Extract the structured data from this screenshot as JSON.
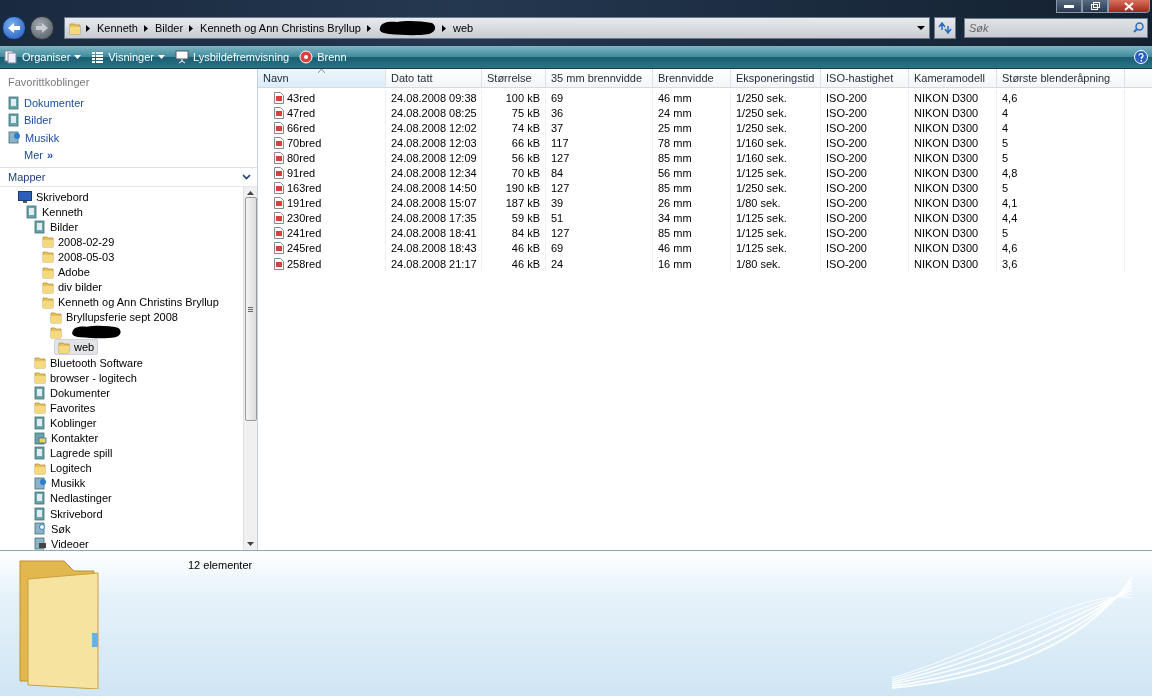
{
  "address_bar": {
    "segments": [
      {
        "kind": "text",
        "label": "Kenneth"
      },
      {
        "kind": "text",
        "label": "Bilder"
      },
      {
        "kind": "text",
        "label": "Kenneth og Ann Christins Bryllup"
      },
      {
        "kind": "redacted"
      },
      {
        "kind": "text",
        "label": "web"
      }
    ]
  },
  "search": {
    "placeholder": "Søk"
  },
  "toolbar": [
    {
      "label": "Organiser",
      "dropdown": true
    },
    {
      "label": "Visninger",
      "dropdown": true
    },
    {
      "label": "Lysbildefremvisning",
      "dropdown": false
    },
    {
      "label": "Brenn",
      "dropdown": false
    }
  ],
  "favorites": {
    "title": "Favorittkoblinger",
    "links": [
      {
        "kind": "documents",
        "label": "Dokumenter"
      },
      {
        "kind": "pictures",
        "label": "Bilder"
      },
      {
        "kind": "music",
        "label": "Musikk"
      },
      {
        "kind": "more",
        "label": "Mer",
        "glyph": "»"
      }
    ]
  },
  "folders": {
    "title": "Mapper",
    "tree": [
      {
        "kind": "desktop",
        "label": "Skrivebord",
        "selected": false,
        "children": [
          {
            "kind": "user",
            "label": "Kenneth",
            "selected": false,
            "children": [
              {
                "kind": "library",
                "label": "Bilder",
                "selected": false,
                "children": [
                  {
                    "kind": "folder",
                    "label": "2008-02-29",
                    "selected": false
                  },
                  {
                    "kind": "folder",
                    "label": "2008-05-03",
                    "selected": false
                  },
                  {
                    "kind": "folder",
                    "label": "Adobe",
                    "selected": false
                  },
                  {
                    "kind": "folder",
                    "label": "div bilder",
                    "selected": false
                  },
                  {
                    "kind": "folder",
                    "label": "Kenneth og Ann Christins Bryllup",
                    "selected": false,
                    "children": [
                      {
                        "kind": "folder",
                        "label": "Bryllupsferie sept 2008",
                        "selected": false
                      },
                      {
                        "kind": "redacted",
                        "selected": false,
                        "children": [
                          {
                            "kind": "folder",
                            "label": "web",
                            "selected": true
                          }
                        ]
                      }
                    ]
                  }
                ]
              },
              {
                "kind": "folder",
                "label": "Bluetooth Software",
                "selected": false
              },
              {
                "kind": "folder",
                "label": "browser - logitech",
                "selected": false
              },
              {
                "kind": "library",
                "label": "Dokumenter",
                "selected": false
              },
              {
                "kind": "folder",
                "label": "Favorites",
                "selected": false
              },
              {
                "kind": "library",
                "label": "Koblinger",
                "selected": false
              },
              {
                "kind": "contacts",
                "label": "Kontakter",
                "selected": false
              },
              {
                "kind": "library",
                "label": "Lagrede spill",
                "selected": false
              },
              {
                "kind": "folder",
                "label": "Logitech",
                "selected": false
              },
              {
                "kind": "music",
                "label": "Musikk",
                "selected": false
              },
              {
                "kind": "library",
                "label": "Nedlastinger",
                "selected": false
              },
              {
                "kind": "library",
                "label": "Skrivebord",
                "selected": false
              },
              {
                "kind": "search",
                "label": "Søk",
                "selected": false
              },
              {
                "kind": "video",
                "label": "Videoer",
                "selected": false
              }
            ]
          }
        ]
      }
    ]
  },
  "table": {
    "columns": [
      {
        "label": "Navn",
        "sorted": true
      },
      {
        "label": "Dato tatt",
        "sorted": false
      },
      {
        "label": "Størrelse",
        "sorted": false
      },
      {
        "label": "35 mm brennvidde",
        "sorted": false
      },
      {
        "label": "Brennvidde",
        "sorted": false
      },
      {
        "label": "Eksponeringstid",
        "sorted": false
      },
      {
        "label": "ISO-hastighet",
        "sorted": false
      },
      {
        "label": "Kameramodell",
        "sorted": false
      },
      {
        "label": "Største blenderåpning",
        "sorted": false
      }
    ],
    "rows": [
      [
        "43red",
        "24.08.2008 09:38",
        "100 kB",
        "69",
        "46 mm",
        "1/250 sek.",
        "ISO-200",
        "NIKON D300",
        "4,6"
      ],
      [
        "47red",
        "24.08.2008 08:25",
        "75 kB",
        "36",
        "24 mm",
        "1/250 sek.",
        "ISO-200",
        "NIKON D300",
        "4"
      ],
      [
        "66red",
        "24.08.2008 12:02",
        "74 kB",
        "37",
        "25 mm",
        "1/250 sek.",
        "ISO-200",
        "NIKON D300",
        "4"
      ],
      [
        "70bred",
        "24.08.2008 12:03",
        "66 kB",
        "117",
        "78 mm",
        "1/160 sek.",
        "ISO-200",
        "NIKON D300",
        "5"
      ],
      [
        "80red",
        "24.08.2008 12:09",
        "56 kB",
        "127",
        "85 mm",
        "1/160 sek.",
        "ISO-200",
        "NIKON D300",
        "5"
      ],
      [
        "91red",
        "24.08.2008 12:34",
        "70 kB",
        "84",
        "56 mm",
        "1/125 sek.",
        "ISO-200",
        "NIKON D300",
        "4,8"
      ],
      [
        "163red",
        "24.08.2008 14:50",
        "190 kB",
        "127",
        "85 mm",
        "1/250 sek.",
        "ISO-200",
        "NIKON D300",
        "5"
      ],
      [
        "191red",
        "24.08.2008 15:07",
        "187 kB",
        "39",
        "26 mm",
        "1/80 sek.",
        "ISO-200",
        "NIKON D300",
        "4,1"
      ],
      [
        "230red",
        "24.08.2008 17:35",
        "59 kB",
        "51",
        "34 mm",
        "1/125 sek.",
        "ISO-200",
        "NIKON D300",
        "4,4"
      ],
      [
        "241red",
        "24.08.2008 18:41",
        "84 kB",
        "127",
        "85 mm",
        "1/125 sek.",
        "ISO-200",
        "NIKON D300",
        "5"
      ],
      [
        "245red",
        "24.08.2008 18:43",
        "46 kB",
        "69",
        "46 mm",
        "1/125 sek.",
        "ISO-200",
        "NIKON D300",
        "4,6"
      ],
      [
        "258red",
        "24.08.2008 21:17",
        "46 kB",
        "24",
        "16 mm",
        "1/80 sek.",
        "ISO-200",
        "NIKON D300",
        "3,6"
      ]
    ]
  },
  "details": {
    "count": "12 elementer"
  }
}
